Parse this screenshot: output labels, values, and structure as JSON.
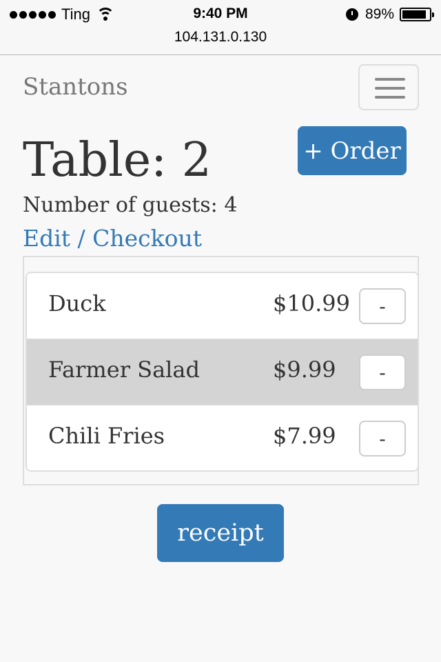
{
  "status_bar": {
    "carrier": "Ting",
    "time": "9:40 PM",
    "battery": "89%",
    "battery_level": 0.89,
    "url": "104.131.0.130",
    "icons": [
      "signal-dots-icon",
      "wifi-icon",
      "alarm-icon",
      "battery-icon"
    ]
  },
  "navbar": {
    "brand": "Stantons",
    "menu_icon": "hamburger-menu-icon"
  },
  "table": {
    "title": "Table: 2",
    "guests": "Number of guests: 4",
    "edit_checkout": "Edit / Checkout",
    "order_button": "+ Order"
  },
  "items": [
    {
      "name": "Duck",
      "price": "$10.99",
      "remove": "-",
      "selected": false
    },
    {
      "name": "Farmer Salad",
      "price": "$9.99",
      "remove": "-",
      "selected": true
    },
    {
      "name": "Chili Fries",
      "price": "$7.99",
      "remove": "-",
      "selected": false
    }
  ],
  "receipt_button": "receipt",
  "colors": {
    "primary": "#337ab7",
    "selected_row": "#d4d4d4",
    "background": "#f8f8f8"
  }
}
